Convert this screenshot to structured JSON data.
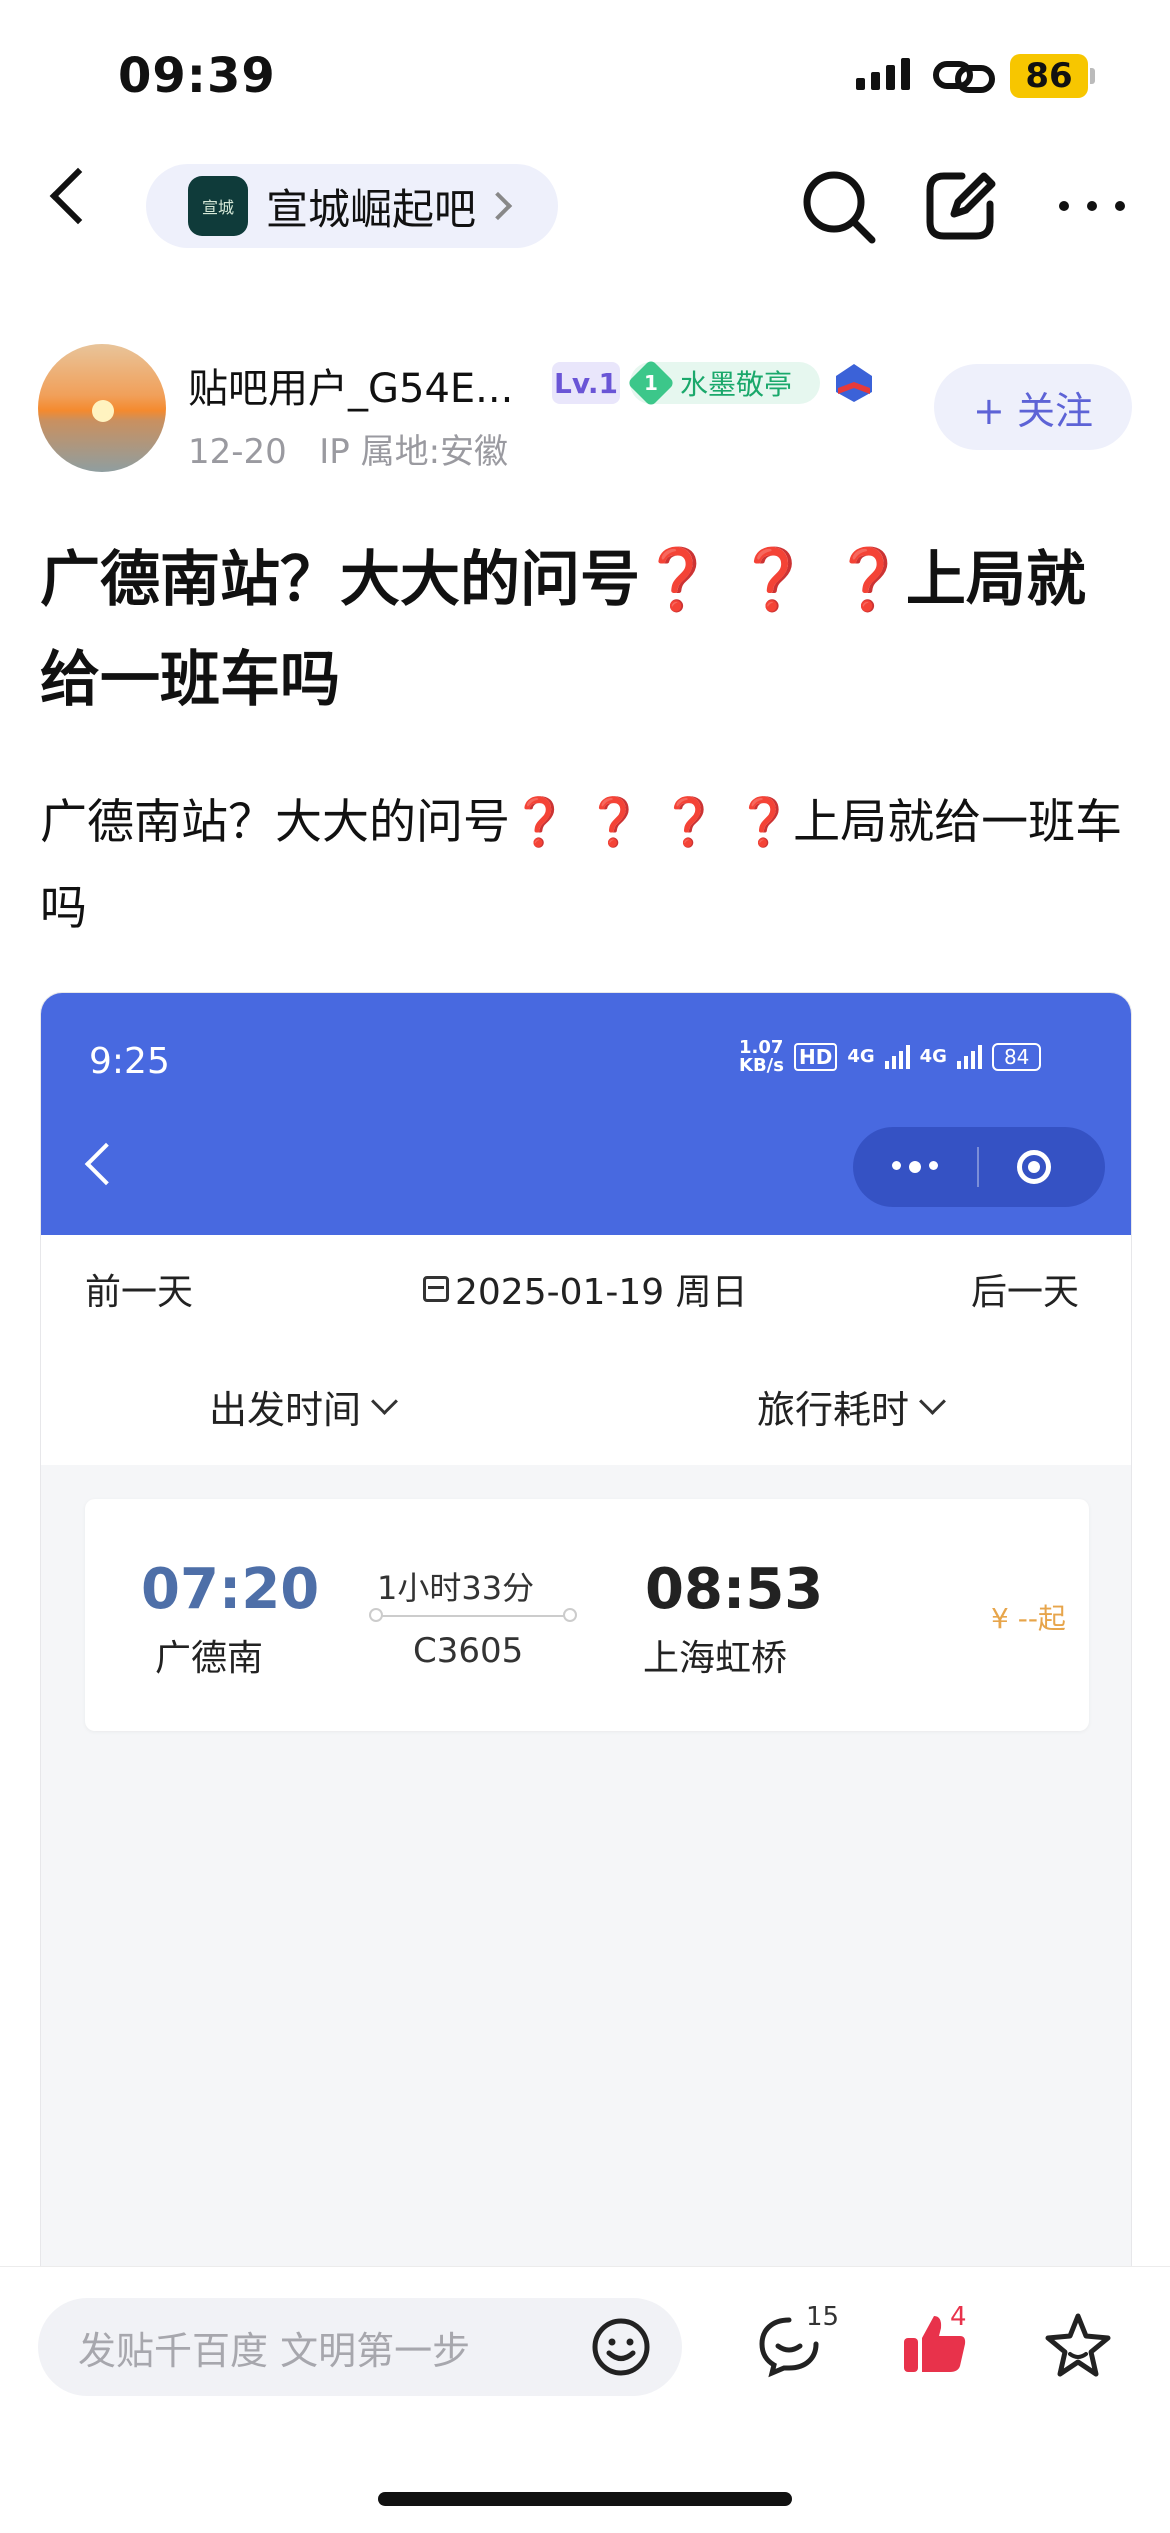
{
  "status_bar": {
    "time": "09:39",
    "battery": "86"
  },
  "nav": {
    "forum_name": "宣城崛起吧",
    "forum_logo_text": "宣城"
  },
  "author": {
    "username": "贴吧用户_G54E...",
    "level": "Lv.1",
    "fan_level": "1",
    "fan_title": "水墨敬亭",
    "date": "12-20",
    "ip_location": "IP 属地:安徽",
    "follow_label": "+ 关注"
  },
  "post": {
    "title_part1": "广德南站？大大的问号",
    "title_marks": "❓ ❓ ❓",
    "title_part2": "上局就给一班车吗",
    "body_part1": "广德南站？大大的问号",
    "body_marks": "❓ ❓ ❓ ❓",
    "body_part2": "上局就给一班车吗"
  },
  "embedded_screenshot": {
    "time": "9:25",
    "net_speed_value": "1.07",
    "net_speed_unit": "KB/s",
    "hd_label": "HD",
    "net_label_1": "4G",
    "net_label_2": "4G",
    "battery": "84",
    "prev_day": "前一天",
    "date": "2025-01-19 周日",
    "next_day": "后一天",
    "sort_departure": "出发时间",
    "sort_duration": "旅行耗时",
    "train": {
      "departure_time": "07:20",
      "departure_station": "广德南",
      "duration": "1小时33分",
      "train_number": "C3605",
      "arrival_time": "08:53",
      "arrival_station": "上海虹桥",
      "price": "¥ --起"
    }
  },
  "bottom_bar": {
    "comment_placeholder": "发贴千百度 文明第一步",
    "comment_count": "15",
    "like_count": "4"
  },
  "colors": {
    "accent": "#5d63d6",
    "embed_header": "#4869e0",
    "question_mark": "#d3161b",
    "like": "#e8324b",
    "battery": "#f7c600"
  }
}
